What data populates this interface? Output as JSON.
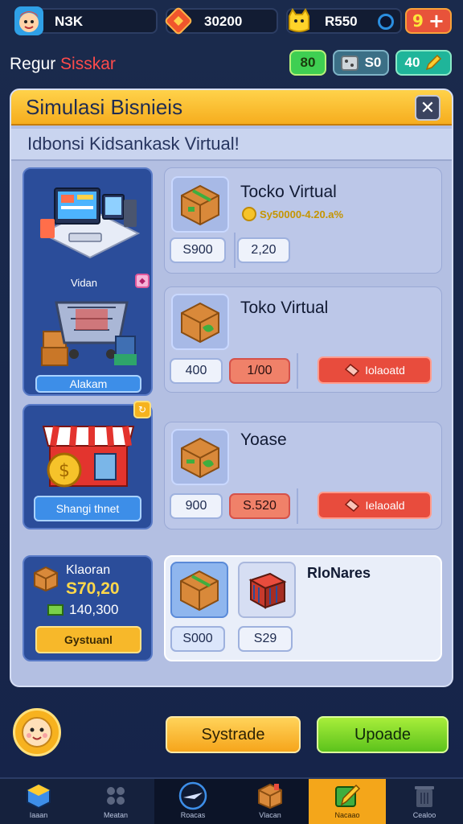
{
  "resources": {
    "player": "NЗK",
    "gems": "30200",
    "coins": "R550",
    "boost": "9"
  },
  "header": {
    "region_prefix": "Regur",
    "region_name": "Sisskar",
    "chips": [
      "80",
      "S0",
      "40"
    ]
  },
  "panel": {
    "title": "Simulasi Bisnieis",
    "close": "✕",
    "subtitle": "Idbonsi Kidsankask Virtual!"
  },
  "left": {
    "tile1_label_top": "Vidan",
    "tile1_button": "Alakam",
    "tile2_button": "Shangi thnet",
    "stats_title": "Klaoran",
    "stats_value": "S70,20",
    "stats_sub": "140,300",
    "stats_button": "Gystuanl"
  },
  "cards": [
    {
      "title": "Tocko Virtual",
      "subtitle": "Sy50000-4.20.a%",
      "price": "S900",
      "stock": "2,20"
    },
    {
      "title": "Toko Virtual",
      "price": "400",
      "stock": "1/00",
      "sell": "Iolaoatd"
    },
    {
      "title": "Yoase",
      "price": "900",
      "stock": "S.520",
      "sell": "Ielaoald"
    },
    {
      "title": "RloNares",
      "price": "S000",
      "stock": "S29"
    }
  ],
  "actions": {
    "left_button": "Systrade",
    "right_button": "Upoade"
  },
  "nav": [
    {
      "label": "Iaaan",
      "icon": "cube-icon"
    },
    {
      "label": "Meatan",
      "icon": "dots-icon"
    },
    {
      "label": "Roacas",
      "icon": "plane-icon"
    },
    {
      "label": "Vlacan",
      "icon": "box-icon"
    },
    {
      "label": "Nacaao",
      "icon": "pencil-icon"
    },
    {
      "label": "Cealoo",
      "icon": "trash-icon"
    }
  ],
  "colors": {
    "background": "#1a2a4c",
    "panel_header": "#f6ad1e",
    "accent_red": "#e84c3d",
    "accent_green": "#5cc21c"
  }
}
